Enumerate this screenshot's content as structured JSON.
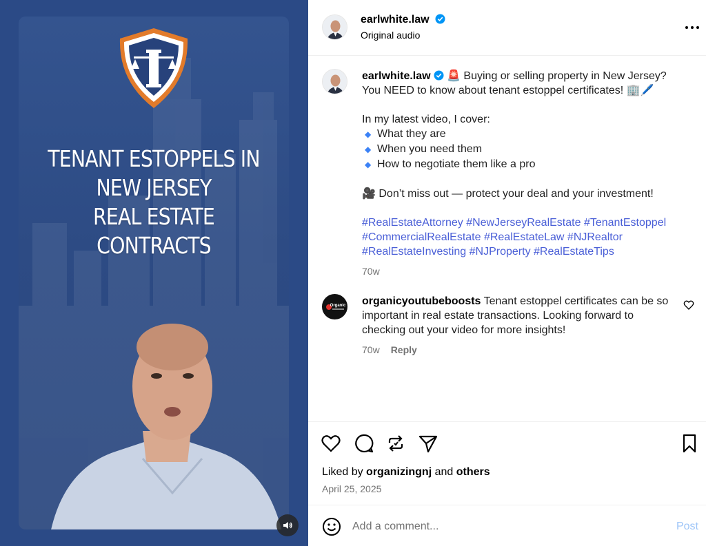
{
  "media": {
    "video_title": "TENANT ESTOPPELS IN\nNEW JERSEY\nREAL ESTATE CONTRACTS",
    "mute_icon": "speaker-icon"
  },
  "header": {
    "username": "earlwhite.law",
    "subtitle": "Original audio",
    "more_icon": "more-dots-icon"
  },
  "caption": {
    "username": "earlwhite.law",
    "line1": "🚨 Buying or selling property in New Jersey?",
    "line2": "You NEED to know about tenant estoppel certificates! 🏢🖊️",
    "intro": "In my latest video, I cover:",
    "bullets": [
      "What they are",
      "When you need them",
      "How to negotiate them like a pro"
    ],
    "cta": "🎥 Don’t miss out — protect your deal and your investment!",
    "hashtags_line1": "#RealEstateAttorney #NewJerseyRealEstate #TenantEstoppel",
    "hashtags_line2": "#CommercialRealEstate #RealEstateLaw #NJRealtor",
    "hashtags_line3": "#RealEstateInvesting #NJProperty #RealEstateTips",
    "time": "70w"
  },
  "comment": {
    "username": "organicyoutubeboosts",
    "text": "Tenant estoppel certificates can be so important in real estate transactions. Looking forward to checking out your video for more insights!",
    "time": "70w",
    "reply_label": "Reply",
    "avatar_text": "Organic"
  },
  "actions": {
    "liked_prefix": "Liked by",
    "liked_user": "organizingnj",
    "liked_and": "and",
    "liked_others": "others",
    "date": "April 25, 2025"
  },
  "comment_bar": {
    "placeholder": "Add a comment...",
    "post_label": "Post"
  },
  "colors": {
    "media_bg": "#2b4a86",
    "link_blue": "#4a5fd7",
    "verified_blue": "#0095f6",
    "post_disabled": "#9ec5f8"
  }
}
